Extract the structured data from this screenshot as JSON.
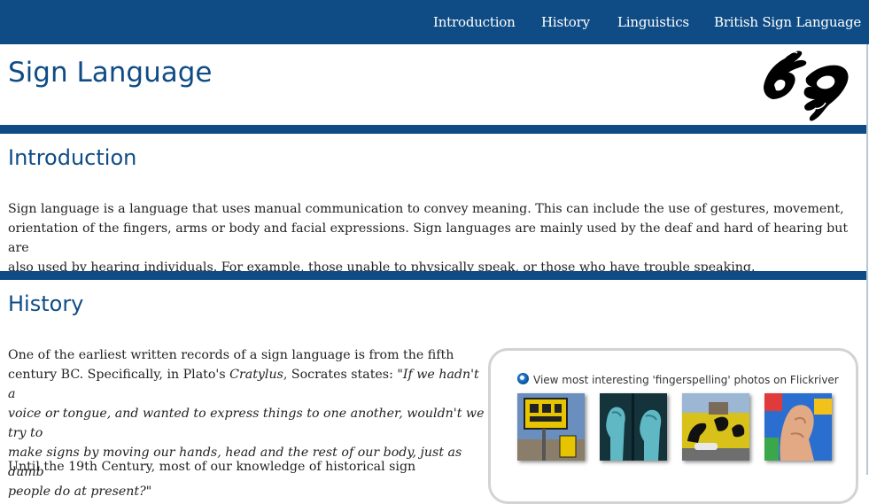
{
  "nav": {
    "items": [
      "Introduction",
      "History",
      "Linguistics",
      "British Sign Language"
    ]
  },
  "header": {
    "title": "Sign Language",
    "logo_icon": "sign-language-hands-icon"
  },
  "sections": {
    "introduction": {
      "heading": "Introduction",
      "lines": [
        "Sign language is a language that uses manual communication to convey meaning. This can include the use of gestures, movement,",
        "orientation of the fingers, arms or body and facial expressions. Sign languages are mainly used by the deaf and hard of hearing but are",
        "also used by hearing individuals. For example, those unable to physically speak, or those who have trouble speaking."
      ]
    },
    "history": {
      "heading": "History",
      "p1": {
        "line1": "One of the earliest written records of a sign language is from the fifth",
        "line2_a": "century BC. Specifically, in Plato's ",
        "line2_b": "Cratylus",
        "line2_c": ", Socrates states: ",
        "line2_d": "\"If we hadn't a",
        "quote_lines": [
          "voice or tongue, and wanted to express things to one another, wouldn't we try to",
          "make signs by moving our hands, head and the rest of our body, just as dumb",
          "people do at present?\""
        ]
      },
      "p2": "Until the 19th Century, most of our knowledge of historical sign"
    }
  },
  "flickr": {
    "label": "View most interesting 'fingerspelling' photos on Flickriver",
    "thumbnails": [
      "sign-board-photo",
      "hands-fingerspelling-photo",
      "hands-mural-photo",
      "finger-closeup-photo"
    ]
  },
  "colors": {
    "brand": "#0f4c85",
    "nav_text": "#ffffff",
    "body_text": "#222222"
  }
}
